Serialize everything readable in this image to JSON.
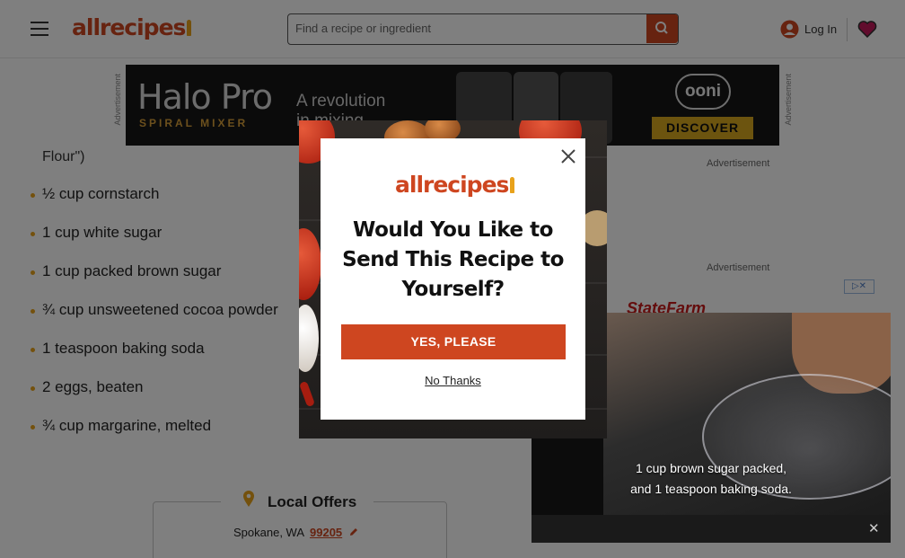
{
  "header": {
    "logo_text": "allrecipes",
    "search_placeholder": "Find a recipe or ingredient",
    "login_label": "Log In"
  },
  "ad_banner": {
    "side_label": "Advertisement",
    "brand": "Halo Pro",
    "brand_sub": "SPIRAL MIXER",
    "tagline_line1": "A revolution",
    "tagline_line2": "in mixing",
    "partner_logo": "ooni",
    "cta": "DISCOVER"
  },
  "ingredients": {
    "cut_off_text": "Flour\")",
    "items": [
      "½ cup cornstarch",
      "1 cup white sugar",
      "1 cup packed brown sugar",
      "¾ cup unsweetened cocoa powder",
      "1 teaspoon baking soda",
      "2 eggs, beaten",
      "¾ cup margarine, melted"
    ]
  },
  "sidebar": {
    "ad_label_1": "Advertisement",
    "ad_label_2": "Advertisement",
    "statefarm_text": "StateFarm"
  },
  "local_offers": {
    "title": "Local Offers",
    "location": "Spokane, WA",
    "zip": "99205"
  },
  "video": {
    "caption_line1": "1 cup brown sugar packed,",
    "caption_line2": "and 1 teaspoon baking soda."
  },
  "modal": {
    "logo_text": "allrecipes",
    "title_line1": "Would You Like to",
    "title_line2": "Send This Recipe to",
    "title_line3": "Yourself?",
    "yes_label": "YES, PLEASE",
    "no_label": "No Thanks"
  },
  "colors": {
    "brand": "#ce4620",
    "accent": "#e8a21b",
    "favorite": "#c2185b"
  }
}
